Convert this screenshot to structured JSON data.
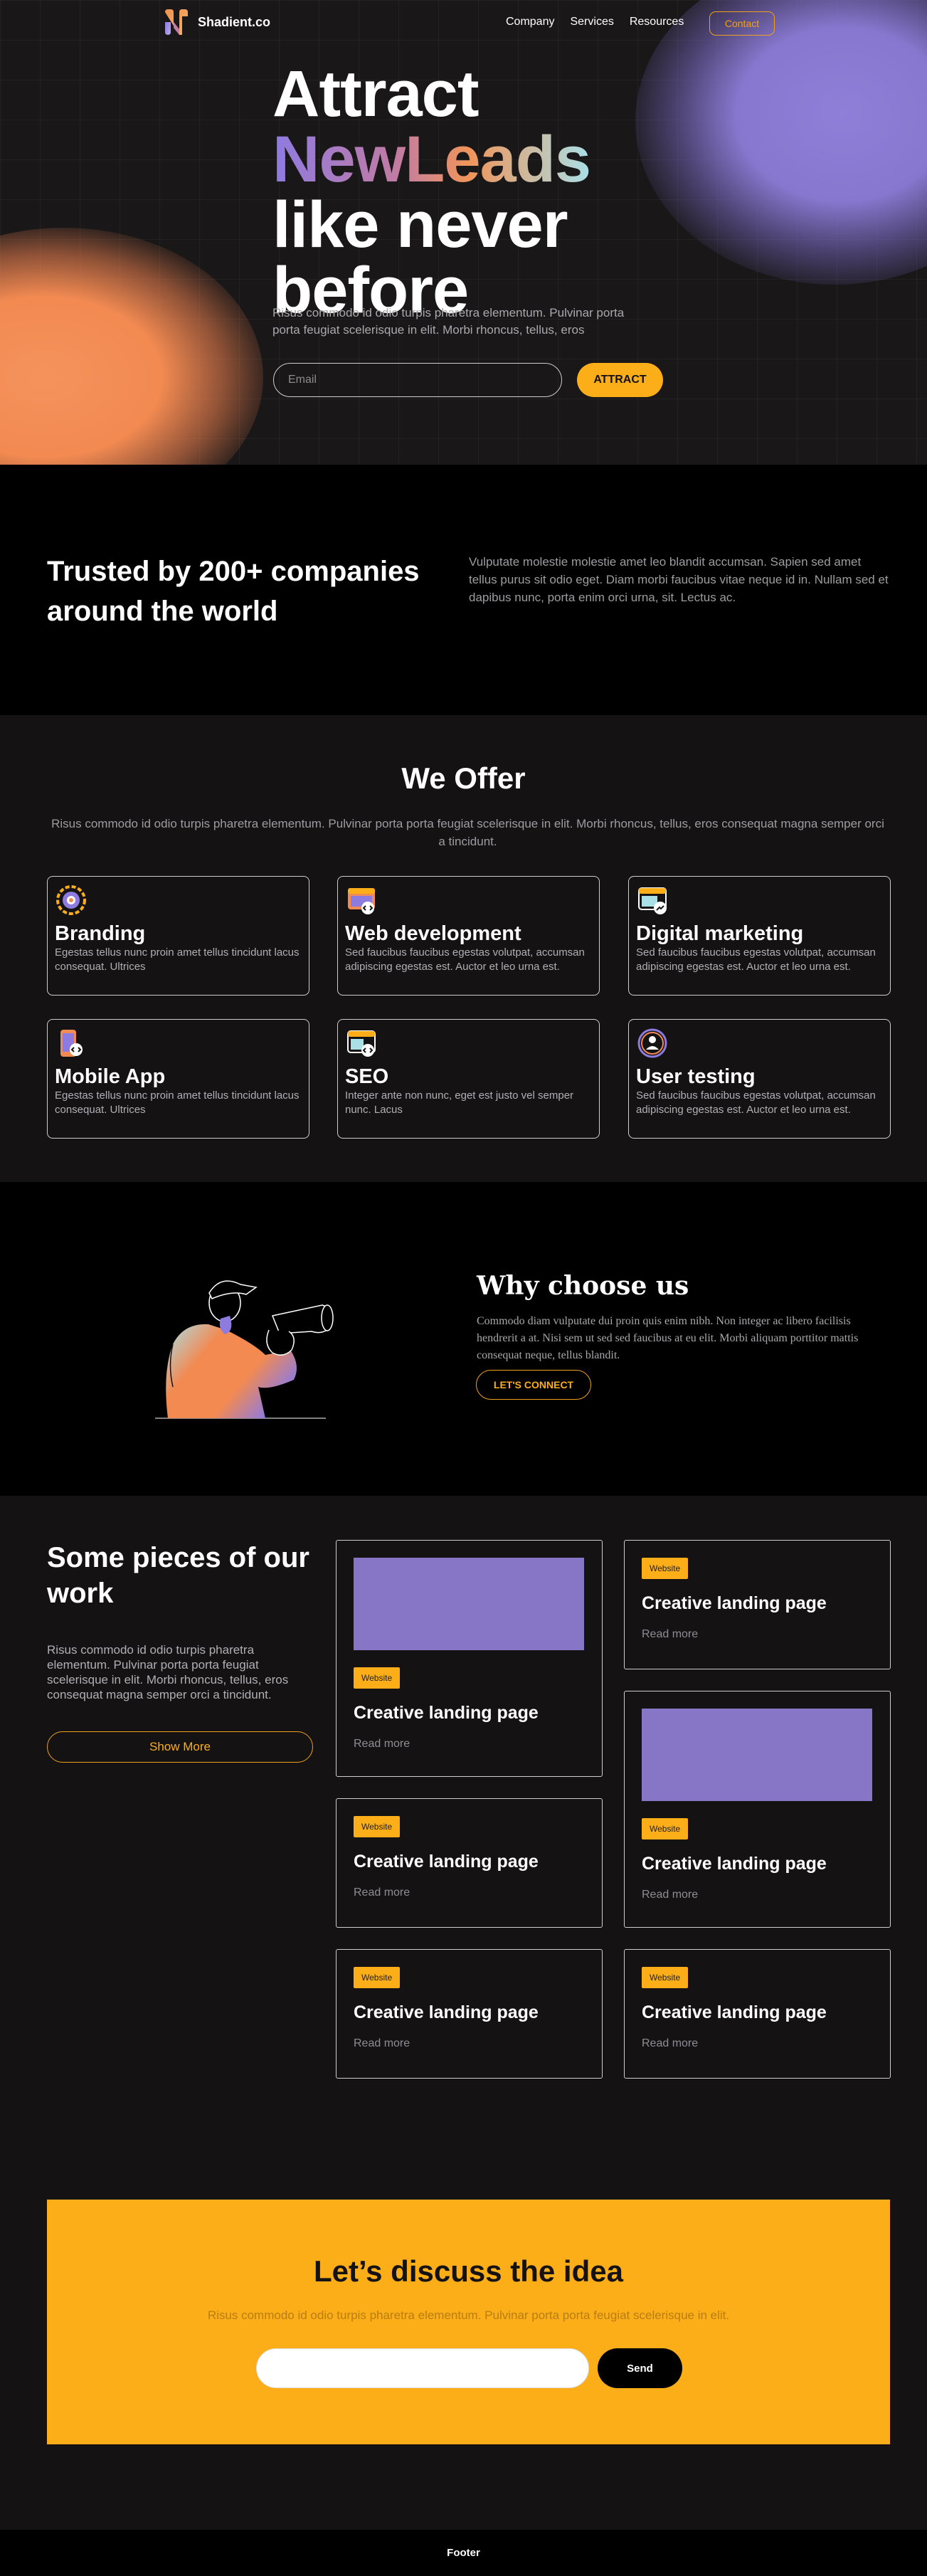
{
  "nav": {
    "brand": "Shadient.co",
    "links": [
      "Company",
      "Services",
      "Resources"
    ],
    "contact_label": "Contact"
  },
  "hero": {
    "line1": "Attract",
    "line2": "NewLeads",
    "line3": "like never",
    "line4": "before",
    "subtitle": "Risus commodo id odio turpis pharetra elementum. Pulvinar porta porta feugiat scelerisque in elit. Morbi rhoncus, tellus, eros",
    "email_placeholder": "Email",
    "cta_label": "ATTRACT"
  },
  "trusted": {
    "title": "Trusted by 200+ companies around the world",
    "text": "Vulputate molestie molestie amet leo blandit accumsan. Sapien sed amet tellus purus sit odio eget. Diam morbi faucibus vitae neque id in. Nullam sed et dapibus nunc, porta enim orci urna, sit. Lectus ac."
  },
  "offer": {
    "title": "We Offer",
    "subtitle": "Risus commodo id odio turpis pharetra elementum. Pulvinar porta porta feugiat scelerisque in elit. Morbi rhoncus, tellus, eros consequat magna semper orci a tincidunt.",
    "cards": [
      {
        "title": "Branding",
        "text": "Egestas tellus nunc proin amet tellus tincidunt lacus consequat. Ultrices",
        "icon": "branding-icon"
      },
      {
        "title": "Web development",
        "text": "Sed faucibus faucibus egestas volutpat, accumsan adipiscing egestas est. Auctor et leo urna est.",
        "icon": "web-dev-icon"
      },
      {
        "title": "Digital marketing",
        "text": "Sed faucibus faucibus egestas volutpat, accumsan adipiscing egestas est. Auctor et leo urna est.",
        "icon": "marketing-icon"
      },
      {
        "title": "Mobile App",
        "text": "Egestas tellus nunc proin amet tellus tincidunt lacus consequat. Ultrices",
        "icon": "mobile-app-icon"
      },
      {
        "title": "SEO",
        "text": "Integer ante non nunc, eget est justo vel semper nunc. Lacus",
        "icon": "seo-icon"
      },
      {
        "title": "User testing",
        "text": "Sed faucibus faucibus egestas volutpat, accumsan adipiscing egestas est. Auctor et leo urna est.",
        "icon": "user-testing-icon"
      }
    ]
  },
  "why": {
    "title": "Why choose us",
    "text": "Commodo diam vulputate dui proin quis enim nibh. Non integer ac libero facilisis hendrerit a at. Nisi sem ut sed sed faucibus at eu elit. Morbi aliquam porttitor mattis consequat neque, tellus blandit.",
    "cta_label": "LET'S CONNECT"
  },
  "work": {
    "title": "Some pieces of our work",
    "text": "Risus commodo id odio turpis pharetra elementum. Pulvinar porta porta feugiat scelerisque in elit. Morbi rhoncus, tellus, eros consequat magna semper orci a tincidunt.",
    "show_more": "Show More",
    "items": [
      {
        "badge": "Website",
        "title": "Creative landing page",
        "link": "Read more"
      },
      {
        "badge": "Website",
        "title": "Creative landing page",
        "link": "Read more"
      },
      {
        "badge": "Website",
        "title": "Creative landing page",
        "link": "Read more"
      },
      {
        "badge": "Website",
        "title": "Creative landing page",
        "link": "Read more"
      },
      {
        "badge": "Website",
        "title": "Creative landing page",
        "link": "Read more"
      },
      {
        "badge": "Website",
        "title": "Creative landing page",
        "link": "Read more"
      }
    ]
  },
  "discuss": {
    "title": "Let’s discuss the idea",
    "subtitle": "Risus commodo id odio turpis pharetra elementum. Pulvinar porta porta feugiat scelerisque in elit.",
    "input_placeholder": "",
    "send_label": "Send"
  },
  "footer": {
    "label": "Footer"
  },
  "colors": {
    "accent": "#fbae17",
    "purple": "#8775c6",
    "orange": "#f28a52",
    "bg": "#141213"
  }
}
